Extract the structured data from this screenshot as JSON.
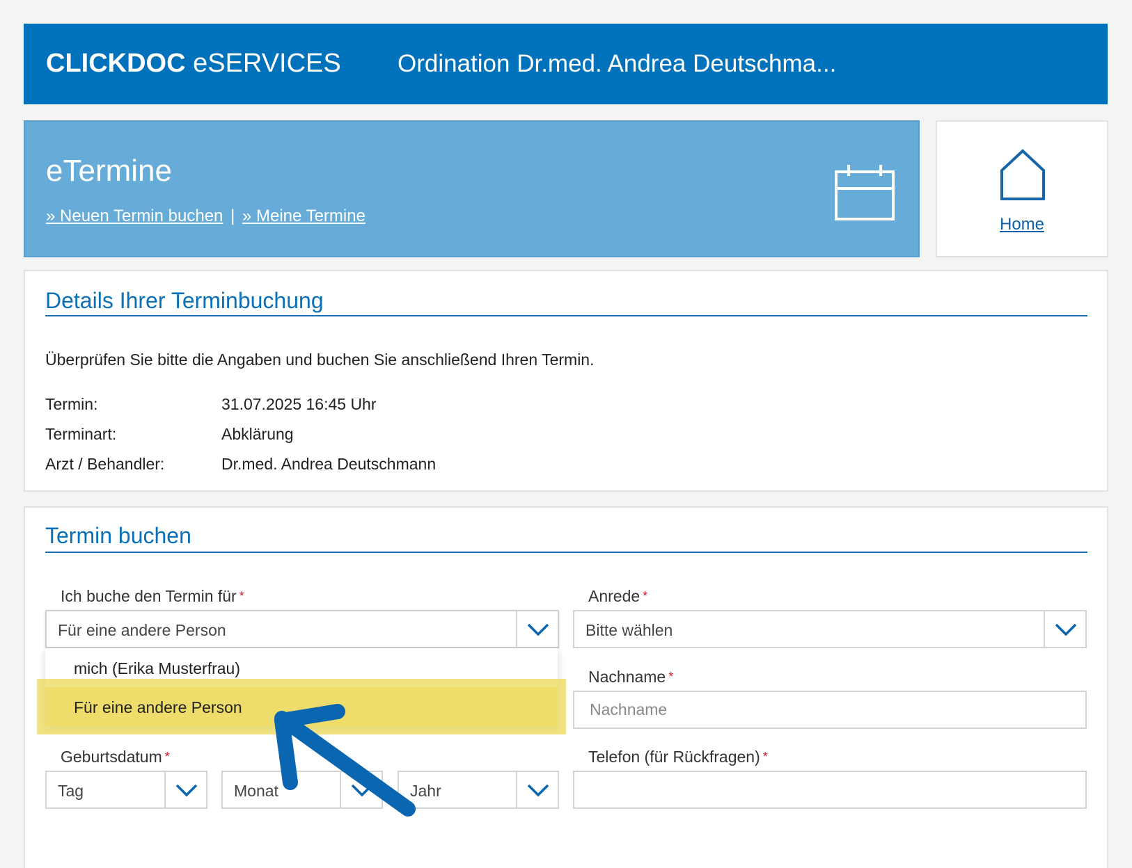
{
  "header": {
    "brand_strong": "CLICKDOC",
    "brand_rest": "eSERVICES",
    "practice": "Ordination Dr.med. Andrea Deutschma..."
  },
  "hero": {
    "title": "eTermine",
    "link_new": "» Neuen Termin buchen",
    "separator": "|",
    "link_mine": "» Meine Termine",
    "icon": "calendar-icon"
  },
  "home": {
    "label": "Home",
    "icon": "home-icon"
  },
  "details": {
    "title": "Details Ihrer Terminbuchung",
    "intro": "Überprüfen Sie bitte die Angaben und buchen Sie anschließend Ihren Termin.",
    "rows": [
      {
        "key": "Termin:",
        "value": "31.07.2025 16:45 Uhr"
      },
      {
        "key": "Terminart:",
        "value": "Abklärung"
      },
      {
        "key": "Arzt / Behandler:",
        "value": "Dr.med. Andrea Deutschmann"
      }
    ]
  },
  "booking": {
    "title": "Termin buchen",
    "required_mark": "*",
    "for_label": "Ich buche den Termin für",
    "for_value": "Für eine andere Person",
    "for_options": [
      "mich (Erika Musterfrau)",
      "Für eine andere Person"
    ],
    "anrede_label": "Anrede",
    "anrede_value": "Bitte wählen",
    "nachname_label": "Nachname",
    "nachname_placeholder": "Nachname",
    "telefon_label": "Telefon (für Rückfragen)",
    "telefon_value": "",
    "geburtsdatum_label": "Geburtsdatum",
    "tag": "Tag",
    "monat": "Monat",
    "jahr": "Jahr"
  },
  "colors": {
    "primary": "#0072bb",
    "hero": "#67acd9",
    "accent_text": "#0a70b8",
    "highlight": "#eedd6a",
    "annotation_arrow": "#0a66b0",
    "required": "#d31c2b"
  }
}
